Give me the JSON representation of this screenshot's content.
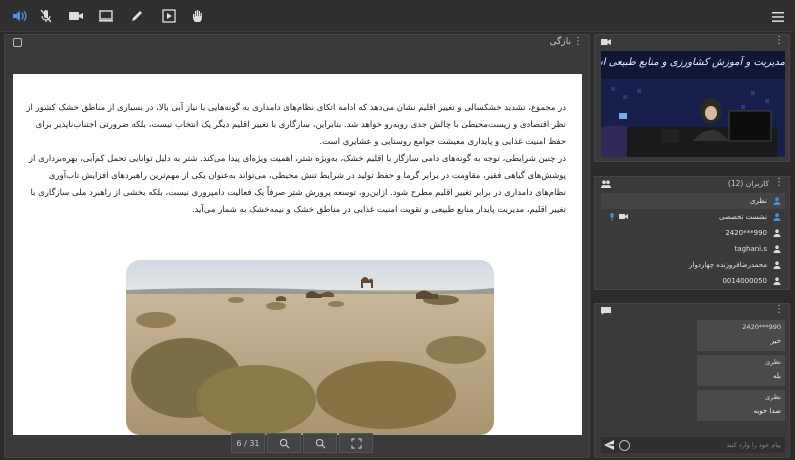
{
  "toolbar": {
    "icons": [
      "speaker-icon",
      "mic-muted-icon",
      "camera-icon",
      "screen-share-icon",
      "pen-icon",
      "play-icon",
      "hand-icon"
    ],
    "menu_icon": "hamburger-icon"
  },
  "presentation": {
    "title": "بازگی",
    "page_label": "6 / 31",
    "paragraphs": [
      "در مجموع، تشدید خشکسالی و تغییر اقلیم نشان می‌دهد که ادامه اتکای نظام‌های دامداری به گونه‌هایی با نیاز آبی بالا، در بسیاری از مناطق خشک کشور از نظر اقتصادی و زیست‌محیطی با چالش جدی روبه‌رو خواهد شد. بنابراین، سازگاری با تغییر اقلیم دیگر یک انتخاب نیست، بلکه ضرورتی اجتناب‌ناپذیر برای حفظ امنیت غذایی و پایداری معیشت جوامع روستایی و عشایری است.",
      "در چنین شرایطی، توجه به گونه‌های دامی سازگار با اقلیم خشک، به‌ویژه شتر، اهمیت ویژه‌ای پیدا می‌کند. شتر به دلیل توانایی تحمل کم‌آبی، بهره‌برداری از پوشش‌های گیاهی فقیر، مقاومت در برابر گرما و حفظ تولید در شرایط تنش محیطی، می‌تواند به‌عنوان یکی از مهم‌ترین راهبردهای افزایش تاب‌آوری نظام‌های دامداری در برابر تغییر اقلیم مطرح شود. ازاین‌رو، توسعه پرورش شتر صرفاً یک فعالیت دامپروری نیست، بلکه بخشی از راهبرد ملی سازگاری با تغییر اقلیم، مدیریت پایدار منابع طبیعی و تقویت امنیت غذایی در مناطق خشک و نیمه‌خشک به شمار می‌آید."
    ]
  },
  "video_panel": {
    "banner_text": "مدیریت و آموزش کشاورزی و منابع طبیعی استان سمنان"
  },
  "users_panel": {
    "title": "کاربران (12)",
    "users": [
      {
        "name": "نظری",
        "highlight": true
      },
      {
        "name": "نشست تخصصی",
        "highlight": false,
        "media": true
      },
      {
        "name": "2420***990",
        "highlight": false
      },
      {
        "name": "taghani.s",
        "highlight": false
      },
      {
        "name": "محمدرضافروزنده چهاردوار",
        "highlight": false
      },
      {
        "name": "0014000050",
        "highlight": false
      }
    ]
  },
  "chat_panel": {
    "messages": [
      {
        "who": "2420***990",
        "text": "خیر"
      },
      {
        "who": "نظری",
        "text": "بله"
      },
      {
        "who": "نظری",
        "text": "صدا خوبه"
      }
    ],
    "input_placeholder": "پیام خود را وارد کنید"
  },
  "colors": {
    "background": "#2b2b2b",
    "panel": "#3a3a3a",
    "accent": "#3a7bd5"
  }
}
